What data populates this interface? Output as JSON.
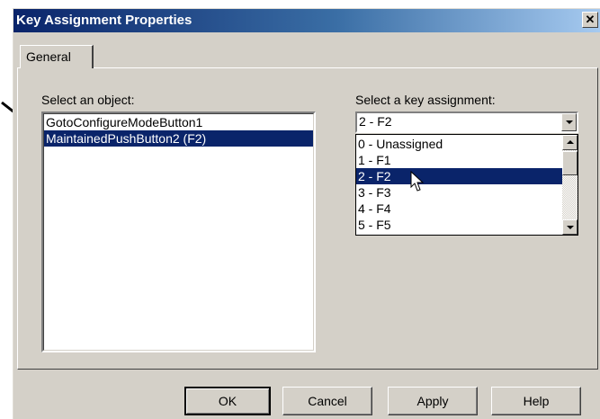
{
  "window": {
    "title": "Key Assignment Properties",
    "close_symbol": "✕"
  },
  "tabs": [
    {
      "label": "General",
      "active": true
    }
  ],
  "object_section": {
    "label": "Select an object:",
    "items": [
      {
        "label": "GotoConfigureModeButton1",
        "selected": false
      },
      {
        "label": "MaintainedPushButton2 (F2)",
        "selected": true
      }
    ]
  },
  "key_section": {
    "label": "Select a key assignment:",
    "combo_value": "2 - F2",
    "options": [
      {
        "label": "0 - Unassigned",
        "selected": false
      },
      {
        "label": "1 - F1",
        "selected": false
      },
      {
        "label": "2 - F2",
        "selected": true
      },
      {
        "label": "3 - F3",
        "selected": false
      },
      {
        "label": "4 - F4",
        "selected": false
      },
      {
        "label": "5 - F5",
        "selected": false
      }
    ]
  },
  "buttons": {
    "ok": "OK",
    "cancel": "Cancel",
    "apply": "Apply",
    "help": "Help"
  },
  "colors": {
    "selection": "#0a246a",
    "titlebar_start": "#0a246a",
    "face": "#d4d0c8"
  },
  "icons": [
    "annotation-arrow",
    "close-icon",
    "mouse-pointer-icon",
    "chevron-down-icon",
    "chevron-up-icon"
  ]
}
